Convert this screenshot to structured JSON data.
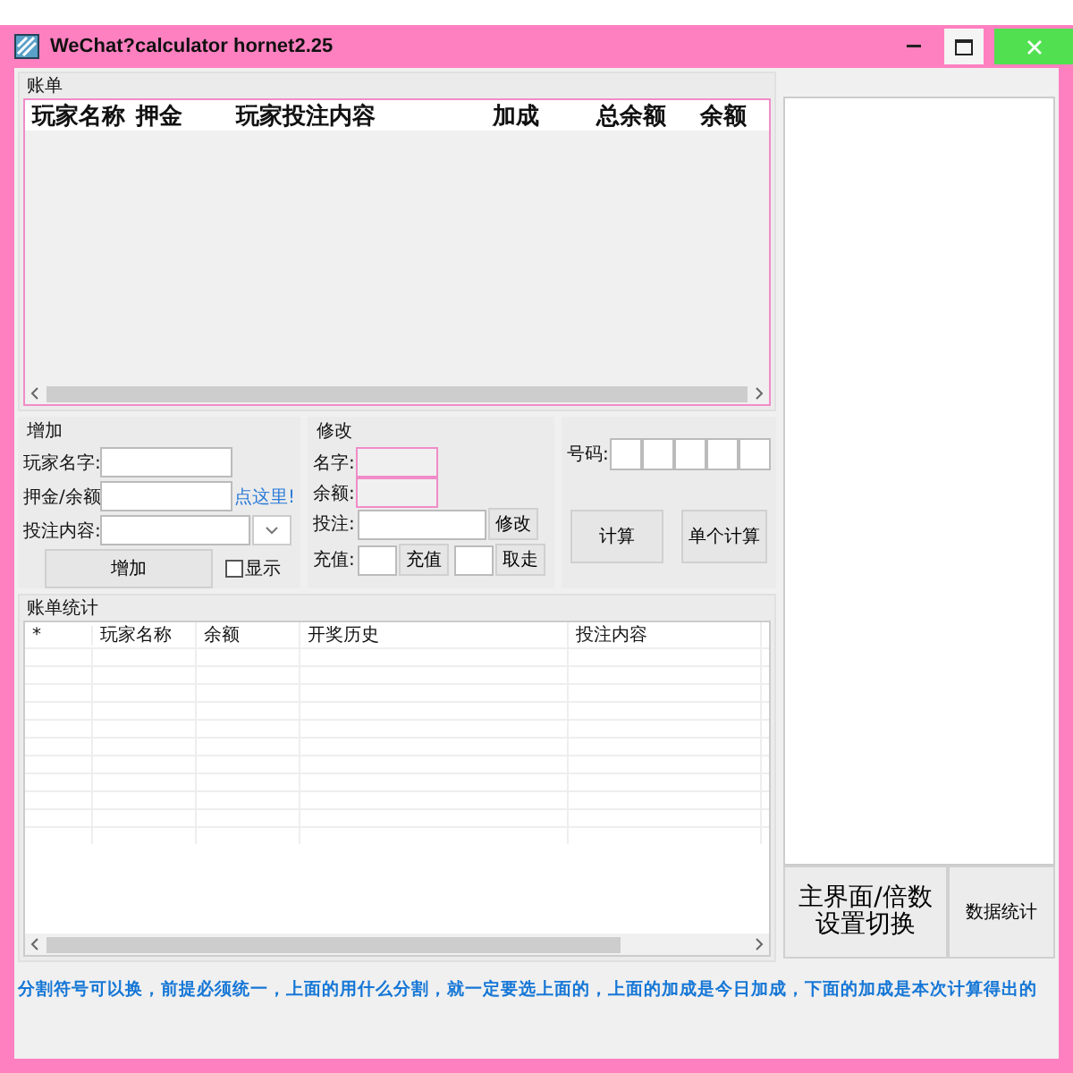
{
  "window": {
    "title": "WeChat?calculator hornet2.25"
  },
  "bill": {
    "title": "账单",
    "columns": [
      "玩家名称",
      "押金",
      "玩家投注内容",
      "加成",
      "总余额",
      "余额"
    ]
  },
  "add": {
    "title": "增加",
    "name_label": "玩家名字:",
    "deposit_label": "押金/余额",
    "link": "点这里!",
    "bet_label": "投注内容:",
    "button": "增加",
    "show": {
      "label": "显示",
      "checked": false
    }
  },
  "modify": {
    "title": "修改",
    "name_label": "名字:",
    "balance_label": "余额:",
    "bet_label": "投注:",
    "modify_button": "修改",
    "recharge_label": "充值:",
    "recharge_button": "充值",
    "withdraw_button": "取走"
  },
  "numbers": {
    "label": "号码:",
    "buttons": [
      "计算",
      "单个计算"
    ]
  },
  "stats": {
    "title": "账单统计",
    "columns": [
      "*",
      "玩家名称",
      "余额",
      "开奖历史",
      "投注内容"
    ]
  },
  "side_buttons": [
    "主界面/倍数设置切换",
    "数据统计"
  ],
  "footer": "分割符号可以换，前提必须统一，上面的用什么分割，就一定要选上面的，上面的加成是今日加成，下面的加成是本次计算得出的"
}
